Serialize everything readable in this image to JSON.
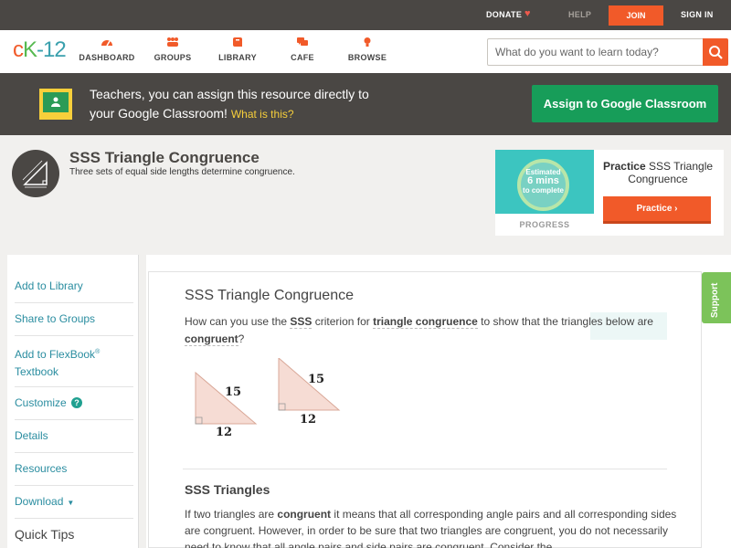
{
  "topbar": {
    "donate": "DONATE",
    "help": "HELP",
    "join": "JOIN",
    "signin": "SIGN IN"
  },
  "nav": {
    "logo": {
      "c": "c",
      "k": "K",
      "n": "-12"
    },
    "items": [
      {
        "label": "DASHBOARD",
        "icon": "dashboard-icon"
      },
      {
        "label": "GROUPS",
        "icon": "groups-icon"
      },
      {
        "label": "LIBRARY",
        "icon": "library-icon"
      },
      {
        "label": "CAFE",
        "icon": "cafe-icon"
      },
      {
        "label": "BROWSE",
        "icon": "browse-icon"
      }
    ],
    "search": {
      "placeholder": "What do you want to learn today?"
    }
  },
  "banner": {
    "line1": "Teachers, you can assign this resource directly to",
    "line2": "your Google Classroom!",
    "what": "What is this?",
    "assign_label": "Assign to Google Classroom"
  },
  "concept": {
    "title": "SSS Triangle Congruence",
    "subtitle": "Three sets of equal side lengths determine congruence."
  },
  "practice": {
    "estimated": "Estimated",
    "mins": "6 mins",
    "to_complete": "to complete",
    "progress": "PROGRESS",
    "heading_bold": "Practice",
    "heading_rest": " SSS Triangle Congruence",
    "button": "Practice"
  },
  "sidebar": {
    "items": [
      {
        "label": "Add to Library"
      },
      {
        "label": "Share to Groups"
      },
      {
        "label": "Add to FlexBook",
        "sup": "®",
        "line2": "Textbook"
      },
      {
        "label": "Customize"
      },
      {
        "label": "Details"
      },
      {
        "label": "Resources"
      },
      {
        "label": "Download"
      }
    ],
    "quick_tips": "Quick Tips"
  },
  "main": {
    "title": "SSS Triangle Congruence",
    "question": {
      "p1": "How can you use the ",
      "t1": "SSS",
      "p2": " criterion for ",
      "t2": "triangle congruence",
      "p3": " to show that the triangles below are ",
      "t3": "congruent",
      "p4": "?"
    },
    "triangles": {
      "t1_hyp": "15",
      "t1_base": "12",
      "t2_hyp": "15",
      "t2_base": "12"
    },
    "section_heading": "SSS Triangles",
    "body": {
      "p1": "If two triangles are ",
      "b1": "congruent",
      "p2": " it means that all corresponding angle pairs and all corresponding sides are congruent. However, in order to be sure that two triangles are congruent, you do not necessarily need to know that all angle pairs and side pairs are congruent. Consider the"
    }
  },
  "support": "Support",
  "colors": {
    "brand_orange": "#f15a29",
    "brand_green": "#179d59",
    "dark_bar": "#4a4744",
    "link_teal": "#2a8da0",
    "support_green": "#7cc35a"
  }
}
